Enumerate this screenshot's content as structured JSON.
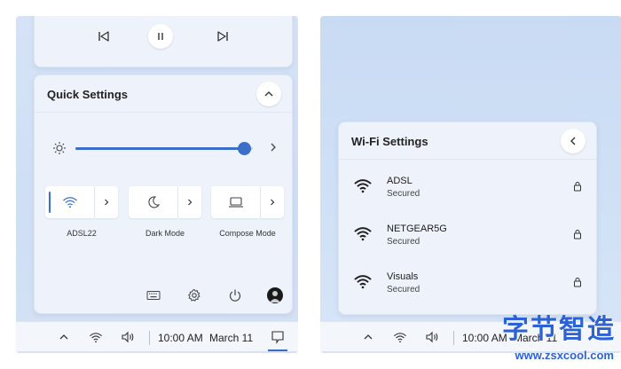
{
  "left": {
    "quick_settings": {
      "title": "Quick Settings",
      "brightness_percent": 95,
      "tiles": [
        {
          "label": "ADSL22",
          "icon": "wifi-icon",
          "active": true
        },
        {
          "label": "Dark Mode",
          "icon": "moon-icon",
          "active": false
        },
        {
          "label": "Compose Mode",
          "icon": "laptop-icon",
          "active": false
        }
      ]
    },
    "taskbar": {
      "time": "10:00 AM",
      "date": "March 11"
    }
  },
  "right": {
    "wifi_settings": {
      "title": "Wi-Fi Settings",
      "networks": [
        {
          "name": "ADSL",
          "status": "Secured"
        },
        {
          "name": "NETGEAR5G",
          "status": "Secured"
        },
        {
          "name": "Visuals",
          "status": "Secured"
        }
      ]
    },
    "taskbar": {
      "time": "10:00 AM",
      "date": "March 11"
    }
  },
  "watermark": {
    "brand": "字节智造",
    "url": "www.zsxcool.com"
  },
  "colors": {
    "accent": "#3b6fc7",
    "card": "#eef3fb",
    "background": "#d3e1f5"
  }
}
